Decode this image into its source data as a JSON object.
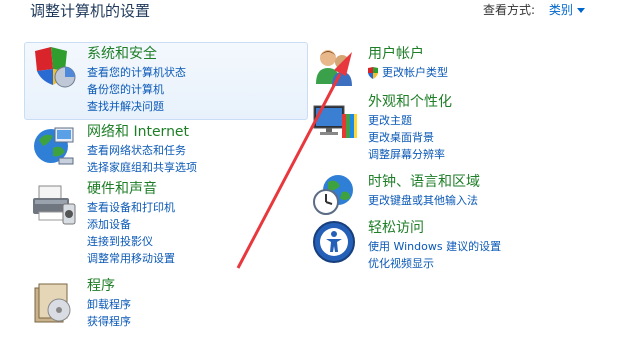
{
  "header": {
    "title": "调整计算机的设置",
    "view_by_label": "查看方式:",
    "view_by_value": "类别"
  },
  "left": [
    {
      "key": "security",
      "title": "系统和安全",
      "links": [
        "查看您的计算机状态",
        "备份您的计算机",
        "查找并解决问题"
      ]
    },
    {
      "key": "network",
      "title": "网络和 Internet",
      "links": [
        "查看网络状态和任务",
        "选择家庭组和共享选项"
      ]
    },
    {
      "key": "hardware",
      "title": "硬件和声音",
      "links": [
        "查看设备和打印机",
        "添加设备",
        "连接到投影仪",
        "调整常用移动设置"
      ]
    },
    {
      "key": "programs",
      "title": "程序",
      "links": [
        "卸载程序",
        "获得程序"
      ]
    }
  ],
  "right": [
    {
      "key": "accounts",
      "title": "用户帐户",
      "links": [
        "更改帐户类型"
      ]
    },
    {
      "key": "appearance",
      "title": "外观和个性化",
      "links": [
        "更改主题",
        "更改桌面背景",
        "调整屏幕分辨率"
      ]
    },
    {
      "key": "clock",
      "title": "时钟、语言和区域",
      "links": [
        "更改键盘或其他输入法"
      ]
    },
    {
      "key": "ease",
      "title": "轻松访问",
      "links": [
        "使用 Windows 建议的设置",
        "优化视频显示"
      ]
    }
  ],
  "colors": {
    "heading": "#1e7e27",
    "link": "#0b59b7",
    "arrow": "#e8383d"
  }
}
